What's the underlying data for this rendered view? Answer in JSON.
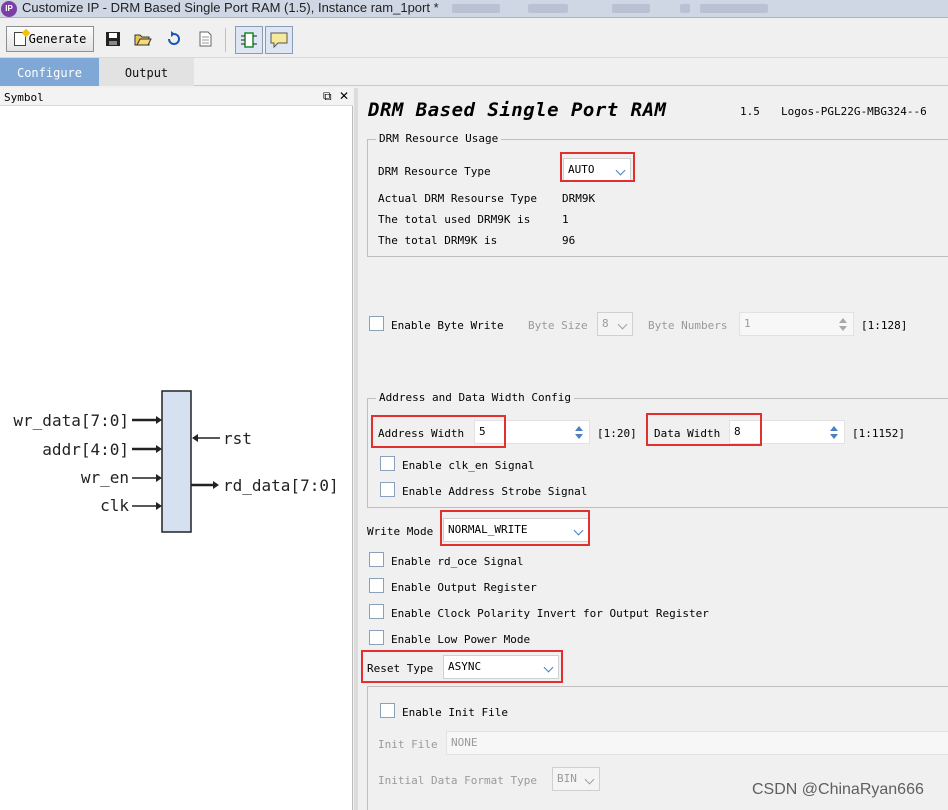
{
  "window": {
    "title": "Customize IP - DRM Based Single Port RAM (1.5), Instance ram_1port *",
    "app_icon": "ip-logo-icon"
  },
  "toolbar": {
    "generate_label": "Generate",
    "icons": [
      "save-icon",
      "open-folder-icon",
      "refresh-icon",
      "document-icon",
      "chip-symbol-icon",
      "comment-icon"
    ]
  },
  "tabs": [
    {
      "label": "Configure",
      "active": true
    },
    {
      "label": "Output",
      "active": false
    }
  ],
  "symbol_panel": {
    "title": "Symbol",
    "controls": [
      "restore-icon",
      "close-icon"
    ],
    "inputs": [
      "wr_data[7:0]",
      "addr[4:0]",
      "wr_en",
      "clk"
    ],
    "right_ports": [
      "rst",
      "rd_data[7:0]"
    ]
  },
  "header": {
    "title": "DRM Based Single Port RAM",
    "version": "1.5",
    "device": "Logos-PGL22G-MBG324--6"
  },
  "drm_resource": {
    "group_title": "DRM Resource Usage",
    "type_label": "DRM Resource Type",
    "type_value": "AUTO",
    "rows": [
      {
        "label": "Actual DRM Resourse Type",
        "value": "DRM9K"
      },
      {
        "label": "The total used DRM9K is",
        "value": "1"
      },
      {
        "label": "The total DRM9K is",
        "value": "96"
      }
    ]
  },
  "byte_write": {
    "enable_label": "Enable Byte Write",
    "byte_size_label": "Byte Size",
    "byte_size_value": "8",
    "byte_numbers_label": "Byte Numbers",
    "byte_numbers_value": "1",
    "byte_numbers_range": "[1:128]"
  },
  "addr_data": {
    "group_title": "Address and Data Width Config",
    "address_width_label": "Address Width",
    "address_width_value": "5",
    "address_width_range": "[1:20]",
    "data_width_label": "Data Width",
    "data_width_value": "8",
    "data_width_range": "[1:1152]",
    "clk_en_label": "Enable clk_en Signal",
    "addr_strobe_label": "Enable Address Strobe Signal"
  },
  "write_mode": {
    "label": "Write Mode",
    "value": "NORMAL_WRITE"
  },
  "options": {
    "rd_oce": "Enable rd_oce Signal",
    "output_register": "Enable Output Register",
    "clock_polarity": "Enable Clock Polarity Invert for Output Register",
    "low_power": "Enable Low Power Mode"
  },
  "reset_type": {
    "label": "Reset Type",
    "value": "ASYNC"
  },
  "init_file": {
    "enable_label": "Enable Init File",
    "file_label": "Init File",
    "file_value": "NONE",
    "format_label": "Initial Data Format Type",
    "format_value": "BIN"
  },
  "watermark": "CSDN @ChinaRyan666",
  "colors": {
    "highlight": "#e03030",
    "active_tab": "#7fa8d6",
    "symbol_block": "#d5e1f0"
  }
}
